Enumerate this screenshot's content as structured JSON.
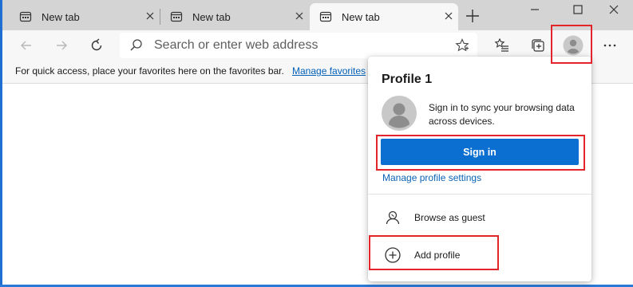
{
  "tabs": [
    {
      "title": "New tab",
      "active": false
    },
    {
      "title": "New tab",
      "active": false
    },
    {
      "title": "New tab",
      "active": true
    }
  ],
  "toolbar": {
    "address_placeholder": "Search or enter web address"
  },
  "favorites_bar": {
    "message": "For quick access, place your favorites here on the favorites bar.",
    "link_label": "Manage favorites"
  },
  "profile_flyout": {
    "title": "Profile 1",
    "signin_message": "Sign in to sync your browsing data across devices.",
    "signin_button": "Sign in",
    "manage_link": "Manage profile settings",
    "items": [
      {
        "label": "Browse as guest",
        "icon": "person-guest-icon"
      },
      {
        "label": "Add profile",
        "icon": "add-circle-icon"
      }
    ]
  },
  "colors": {
    "accent": "#0a6fd1",
    "highlight": "#e3242b",
    "link": "#0b63b6"
  }
}
